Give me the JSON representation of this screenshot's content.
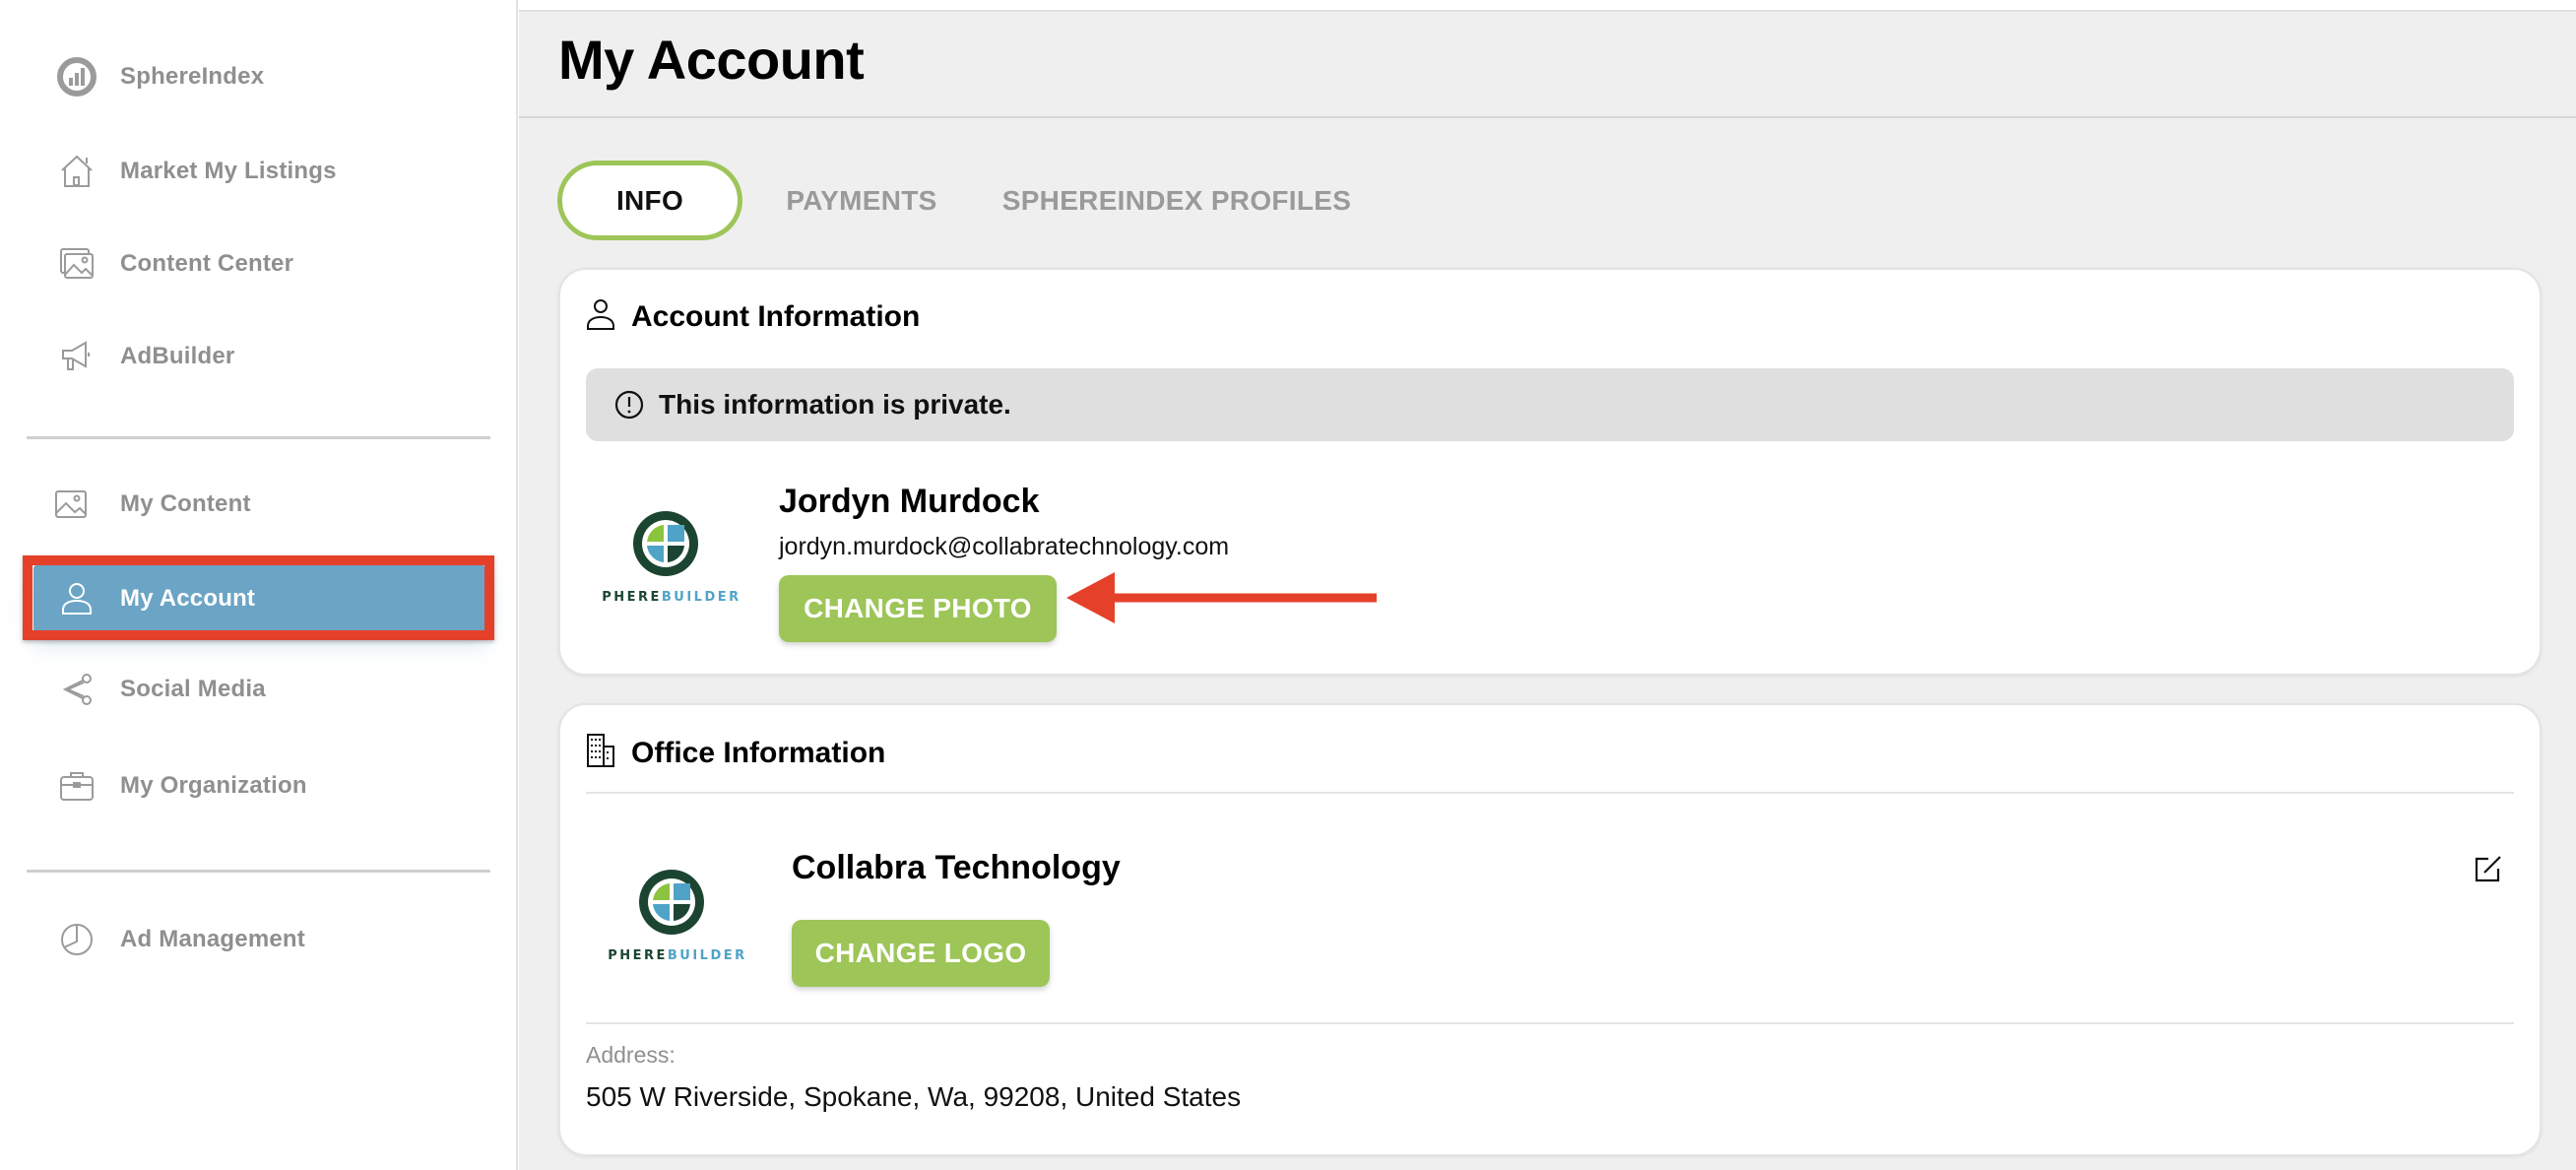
{
  "sidebar": {
    "items": [
      {
        "label": "SphereIndex",
        "icon": "sphereindex-logo-icon",
        "active": false
      },
      {
        "label": "Market My Listings",
        "icon": "house-icon",
        "active": false
      },
      {
        "label": "Content Center",
        "icon": "gallery-icon",
        "active": false
      },
      {
        "label": "AdBuilder",
        "icon": "megaphone-icon",
        "active": false
      },
      {
        "label": "My Content",
        "icon": "image-icon",
        "active": false
      },
      {
        "label": "My Account",
        "icon": "user-icon",
        "active": true
      },
      {
        "label": "Social Media",
        "icon": "share-icon",
        "active": false
      },
      {
        "label": "My Organization",
        "icon": "briefcase-icon",
        "active": false
      },
      {
        "label": "Ad Management",
        "icon": "pie-chart-icon",
        "active": false
      }
    ]
  },
  "header": {
    "title": "My Account"
  },
  "tabs": [
    {
      "label": "INFO",
      "active": true
    },
    {
      "label": "PAYMENTS",
      "active": false
    },
    {
      "label": "SPHEREINDEX PROFILES",
      "active": false
    }
  ],
  "account_card": {
    "title": "Account Information",
    "icon": "user-icon",
    "banner_icon": "alert-circle-icon",
    "banner_text": "This information is private.",
    "logo_text": "SPHEREBUILDER",
    "name": "Jordyn Murdock",
    "email": "jordyn.murdock@collabratechnology.com",
    "change_photo_label": "CHANGE PHOTO"
  },
  "office_card": {
    "title": "Office Information",
    "icon": "building-icon",
    "logo_text": "SPHEREBUILDER",
    "company_name": "Collabra Technology",
    "change_logo_label": "CHANGE LOGO",
    "edit_icon": "edit-icon",
    "address_label": "Address:",
    "address_value": "505 W Riverside, Spokane, Wa, 99208, United States"
  },
  "colors": {
    "accent_green": "#9dc558",
    "active_nav_blue": "#6ba4c4",
    "annotation_red": "#e5412a",
    "nav_text_gray": "#8f8f8f",
    "main_bg": "#efefef"
  }
}
